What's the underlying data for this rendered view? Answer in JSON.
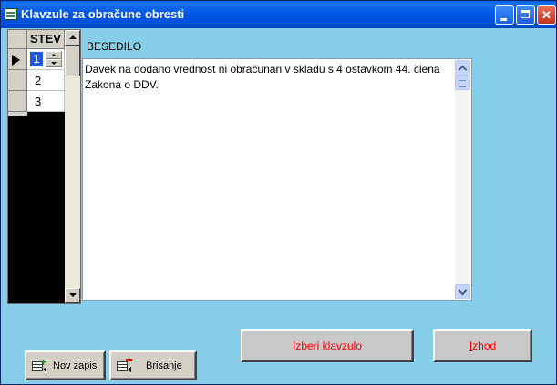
{
  "window": {
    "title": "Klavzule za obračune  obresti"
  },
  "grid": {
    "column_header": "STEV",
    "rows": [
      "1",
      "2",
      "3"
    ],
    "selected_row": 0
  },
  "memo": {
    "label": "BESEDILO",
    "text": "Davek na dodano vrednost ni obračunan v skladu s 4 ostavkom 44. člena Zakona o DDV."
  },
  "buttons": {
    "izberi": "Izberi klavzulo",
    "izhod_underline": "I",
    "izhod_rest": "zhod",
    "nov_zapis": "Nov zapis",
    "brisanje": "Brisanje"
  },
  "colors": {
    "background": "#87ceeb",
    "titlebar": "#0055e5",
    "button_text_accent": "#ff0000"
  }
}
